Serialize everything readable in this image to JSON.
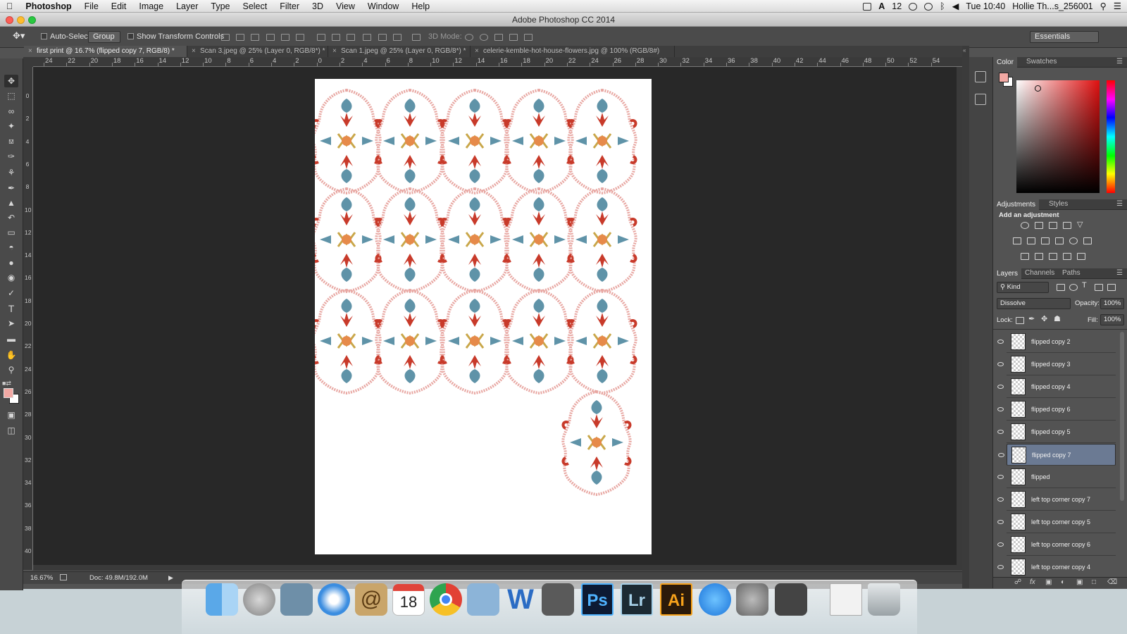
{
  "menubar": {
    "app": "Photoshop",
    "items": [
      "File",
      "Edit",
      "Image",
      "Layer",
      "Type",
      "Select",
      "Filter",
      "3D",
      "View",
      "Window",
      "Help"
    ],
    "badge_count": "12",
    "clock": "Tue 10:40",
    "user": "Hollie Th...s_256001"
  },
  "window": {
    "title": "Adobe Photoshop CC 2014"
  },
  "options": {
    "auto_select_label": "Auto-Select:",
    "auto_select_value": "Group",
    "show_transform_label": "Show Transform Controls",
    "mode_3d_label": "3D Mode:",
    "workspace": "Essentials"
  },
  "tabs": [
    {
      "label": "first print @ 16.7% (flipped copy 7, RGB/8) *"
    },
    {
      "label": "Scan 3.jpeg @ 25% (Layer 0, RGB/8*) *"
    },
    {
      "label": "Scan 1.jpeg @ 25% (Layer 0, RGB/8*) *"
    },
    {
      "label": "celerie-kemble-hot-house-flowers.jpg @ 100% (RGB/8#)"
    }
  ],
  "ruler": {
    "h_labels": [
      "24",
      "22",
      "20",
      "18",
      "16",
      "14",
      "12",
      "10",
      "8",
      "6",
      "4",
      "2",
      "0",
      "2",
      "4",
      "6",
      "8",
      "10",
      "12",
      "14",
      "16",
      "18",
      "20",
      "22",
      "24",
      "26",
      "28",
      "30",
      "32",
      "34",
      "36",
      "38",
      "40",
      "42",
      "44",
      "46",
      "48",
      "50",
      "52",
      "54"
    ],
    "v_labels": [
      "0",
      "2",
      "4",
      "6",
      "8",
      "10",
      "12",
      "14",
      "16",
      "18",
      "20",
      "22",
      "24",
      "26",
      "28",
      "30",
      "32",
      "34",
      "36",
      "38",
      "40",
      "42"
    ]
  },
  "status": {
    "zoom": "16.67%",
    "doc": "Doc: 49.8M/192.0M"
  },
  "panels": {
    "color_tabs": [
      "Color",
      "Swatches"
    ],
    "adjust_tabs": [
      "Adjustments",
      "Styles"
    ],
    "add_adjustment": "Add an adjustment",
    "layers_tabs": [
      "Layers",
      "Channels",
      "Paths"
    ],
    "kind_filter": "Kind",
    "blend_mode": "Dissolve",
    "opacity_label": "Opacity:",
    "opacity_value": "100%",
    "lock_label": "Lock:",
    "fill_label": "Fill:",
    "fill_value": "100%",
    "layers": [
      {
        "name": "flipped copy 2",
        "selected": false
      },
      {
        "name": "flipped copy 3",
        "selected": false
      },
      {
        "name": "flipped copy 4",
        "selected": false
      },
      {
        "name": "flipped copy 6",
        "selected": false
      },
      {
        "name": "flipped copy 5",
        "selected": false
      },
      {
        "name": "flipped copy 7",
        "selected": true
      },
      {
        "name": "flipped",
        "selected": false
      },
      {
        "name": "left top corner copy 7",
        "selected": false
      },
      {
        "name": "left top corner copy 5",
        "selected": false
      },
      {
        "name": "left top corner copy 6",
        "selected": false
      },
      {
        "name": "left top corner copy 4",
        "selected": false
      }
    ]
  },
  "dock": {
    "apps": [
      "finder-icon",
      "launchpad-icon",
      "preview-icon",
      "safari-icon",
      "contacts-icon",
      "calendar-icon",
      "chrome-icon",
      "image-capture-icon",
      "word-icon",
      "photo-booth-icon",
      "photoshop-icon",
      "lightroom-icon",
      "illustrator-icon",
      "app-store-icon",
      "system-preferences-icon",
      "finder-window-icon",
      "document-icon",
      "trash-icon"
    ],
    "calendar_day": "18",
    "ps_label": "Ps",
    "lr_label": "Lr",
    "ai_label": "Ai",
    "w_label": "W"
  },
  "colors": {
    "foreground": "#f2a9a4",
    "ornament_red": "#c83a2a",
    "ornament_pink": "#e8a7a2",
    "ornament_blue": "#5f93a8",
    "ornament_gold": "#c9a74a"
  }
}
